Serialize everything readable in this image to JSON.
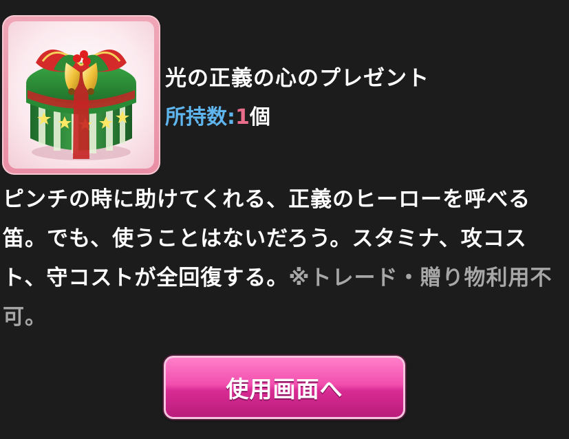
{
  "item": {
    "title": "光の正義の心のプレゼント",
    "image_icon": "gift-box-icon",
    "owned_label": "所持数:",
    "owned_count": "1",
    "owned_unit": "個",
    "description_main": "ピンチの時に助けてくれる、正義のヒーローを呼べる笛。でも、使うことはないだろう。スタミナ、攻コスト、守コストが全回復する。",
    "description_note": "※トレード・贈り物利用不可。"
  },
  "actions": {
    "use_button_label": "使用画面へ"
  },
  "colors": {
    "background": "#1c1c1c",
    "owned_label": "#5fb6ee",
    "owned_count": "#e96d8a",
    "note_text": "#a7a7a7",
    "button_pink": "#f24fae",
    "frame_pink": "#e98fa5"
  }
}
